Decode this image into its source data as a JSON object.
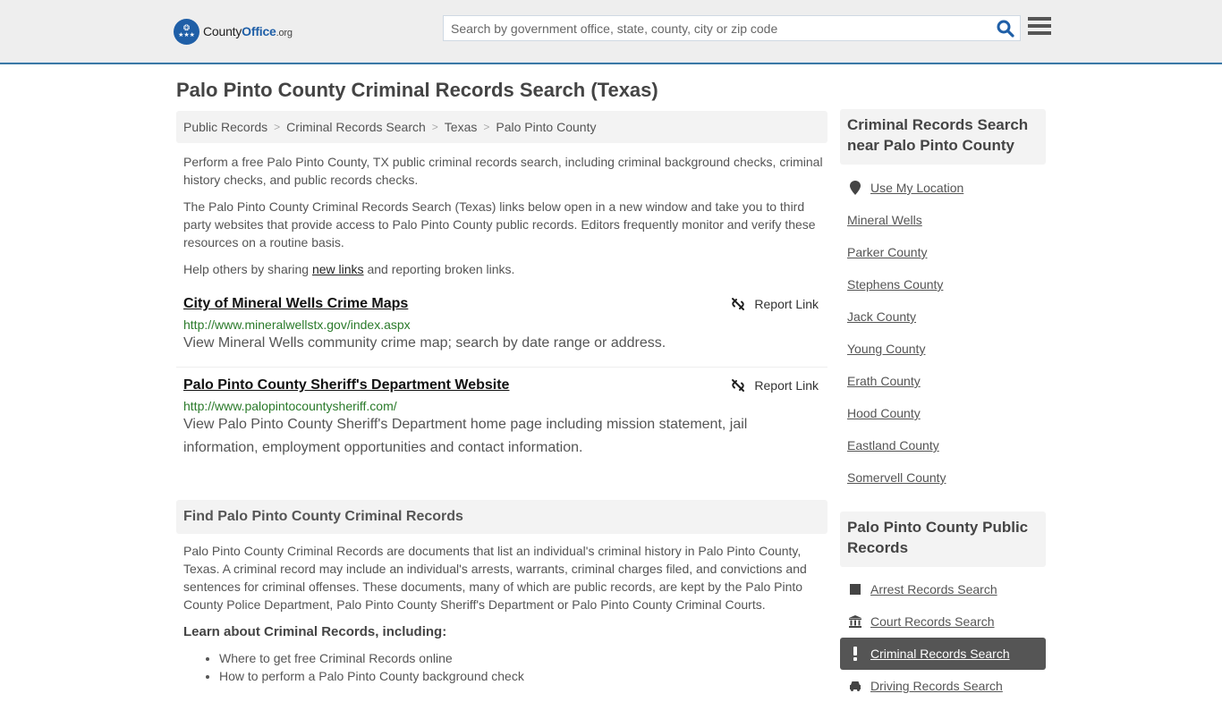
{
  "header": {
    "logo": {
      "name_part1": "County",
      "name_part2": "Office",
      "tld": ".org"
    },
    "search": {
      "placeholder": "Search by government office, state, county, city or zip code",
      "value": ""
    }
  },
  "page_title": "Palo Pinto County Criminal Records Search (Texas)",
  "breadcrumb": [
    {
      "label": "Public Records"
    },
    {
      "label": "Criminal Records Search"
    },
    {
      "label": "Texas"
    },
    {
      "label": "Palo Pinto County"
    }
  ],
  "intro": {
    "p1": "Perform a free Palo Pinto County, TX public criminal records search, including criminal background checks, criminal history checks, and public records checks.",
    "p2": "The Palo Pinto County Criminal Records Search (Texas) links below open in a new window and take you to third party websites that provide access to Palo Pinto County public records. Editors frequently monitor and verify these resources on a routine basis.",
    "p3_before": "Help others by sharing ",
    "p3_link": "new links",
    "p3_after": " and reporting broken links."
  },
  "links": [
    {
      "title": "City of Mineral Wells Crime Maps",
      "url": "http://www.mineralwellstx.gov/index.aspx",
      "description": "View Mineral Wells community crime map; search by date range or address.",
      "report_label": "Report Link"
    },
    {
      "title": "Palo Pinto County Sheriff's Department Website",
      "url": "http://www.palopintocountysheriff.com/",
      "description": "View Palo Pinto County Sheriff's Department home page including mission statement, jail information, employment opportunities and contact information.",
      "report_label": "Report Link"
    }
  ],
  "find_section": {
    "heading": "Find Palo Pinto County Criminal Records",
    "body": "Palo Pinto County Criminal Records are documents that list an individual's criminal history in Palo Pinto County, Texas. A criminal record may include an individual's arrests, warrants, criminal charges filed, and convictions and sentences for criminal offenses. These documents, many of which are public records, are kept by the Palo Pinto County Police Department, Palo Pinto County Sheriff's Department or Palo Pinto County Criminal Courts.",
    "learn_heading": "Learn about Criminal Records, including:",
    "learn_items": [
      "Where to get free Criminal Records online",
      "How to perform a Palo Pinto County background check"
    ]
  },
  "sidebar": {
    "nearby": {
      "heading": "Criminal Records Search near Palo Pinto County",
      "use_location": "Use My Location",
      "items": [
        "Mineral Wells",
        "Parker County",
        "Stephens County",
        "Jack County",
        "Young County",
        "Erath County",
        "Hood County",
        "Eastland County",
        "Somervell County"
      ]
    },
    "public_records": {
      "heading": "Palo Pinto County Public Records",
      "items": [
        {
          "label": "Arrest Records Search",
          "icon": "square-icon",
          "active": false
        },
        {
          "label": "Court Records Search",
          "icon": "courthouse-icon",
          "active": false
        },
        {
          "label": "Criminal Records Search",
          "icon": "exclamation-icon",
          "active": true
        },
        {
          "label": "Driving Records Search",
          "icon": "car-icon",
          "active": false
        }
      ]
    }
  },
  "colors": {
    "brand_blue": "#1f5fa7",
    "header_bg": "#eeeeee",
    "header_border": "#3a78a6",
    "url_green": "#2a7a2a",
    "active_item_bg": "#555555"
  }
}
